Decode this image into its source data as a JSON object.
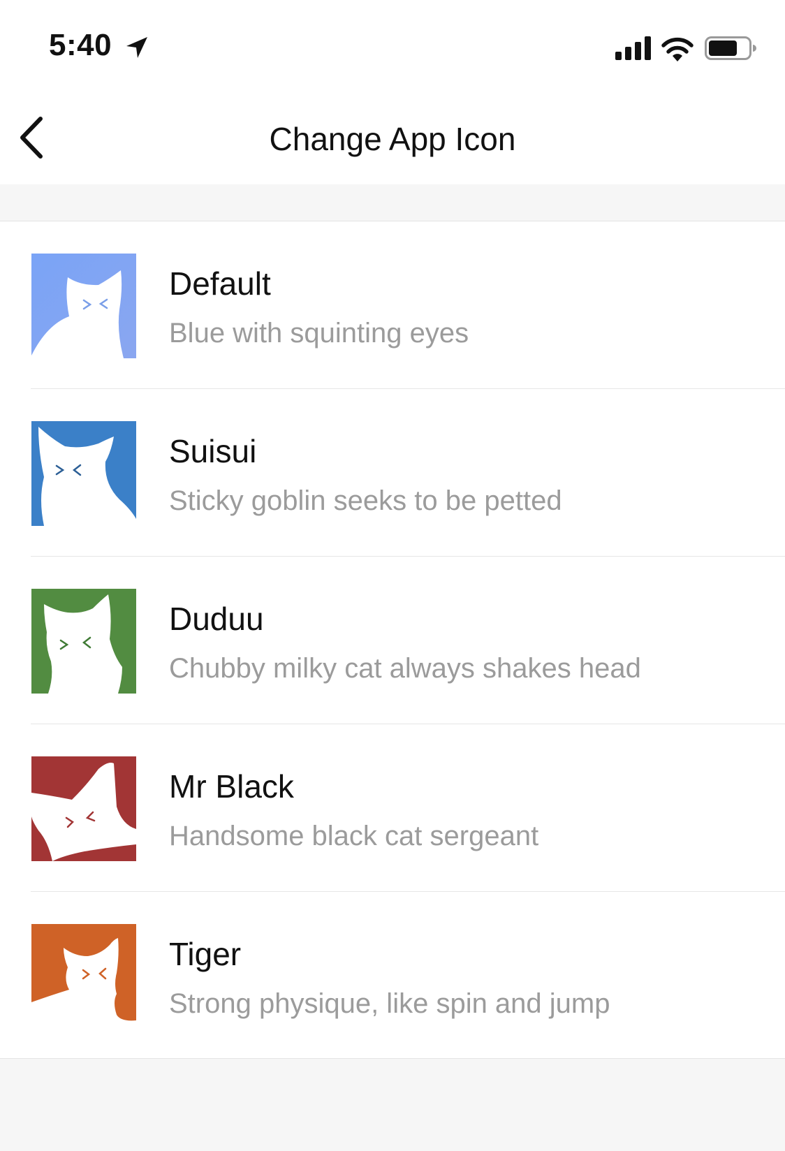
{
  "status_bar": {
    "time": "5:40",
    "icons": [
      "location-arrow-icon",
      "cellular-signal-icon",
      "wifi-icon",
      "battery-icon"
    ]
  },
  "nav": {
    "back_icon": "chevron-left-icon",
    "title": "Change App Icon"
  },
  "icons": [
    {
      "title": "Default",
      "subtitle": "Blue with squinting eyes",
      "color": "#84a8f4",
      "eye_color": "#7a9ee8"
    },
    {
      "title": "Suisui",
      "subtitle": "Sticky goblin seeks to be petted",
      "color": "#3b80c8",
      "eye_color": "#2c5f96"
    },
    {
      "title": "Duduu",
      "subtitle": "Chubby milky cat always shakes head",
      "color": "#528c41",
      "eye_color": "#3f7a34"
    },
    {
      "title": "Mr Black",
      "subtitle": "Handsome black cat sergeant",
      "color": "#a23535",
      "eye_color": "#a23535"
    },
    {
      "title": "Tiger",
      "subtitle": "Strong physique, like spin and jump",
      "color": "#cf6227",
      "eye_color": "#cf6227"
    }
  ]
}
